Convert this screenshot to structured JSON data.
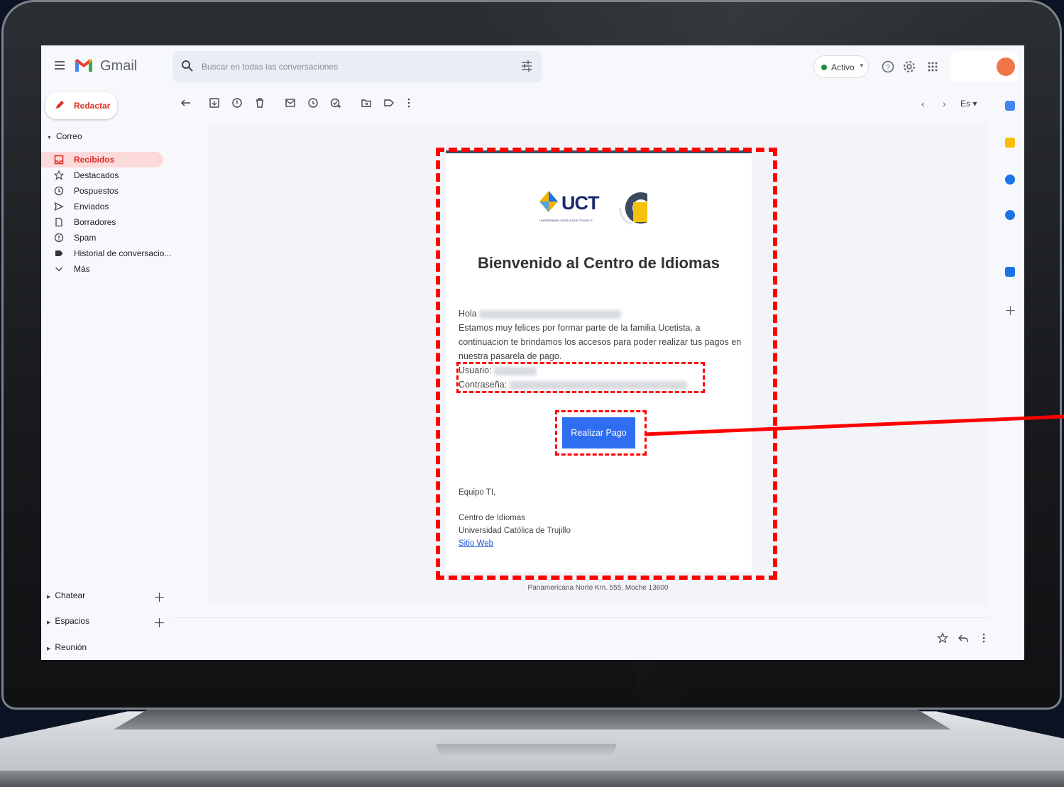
{
  "gmail": {
    "brand": "Gmail",
    "search_placeholder": "Buscar en todas las conversaciones",
    "status": "Activo",
    "compose_label": "Redactar",
    "language": "Es",
    "mail_section": "Correo",
    "nav_items": [
      {
        "label": "Recibidos",
        "icon": "inbox-icon",
        "active": true
      },
      {
        "label": "Destacados",
        "icon": "star-icon",
        "active": false
      },
      {
        "label": "Pospuestos",
        "icon": "clock-icon",
        "active": false
      },
      {
        "label": "Enviados",
        "icon": "send-icon",
        "active": false
      },
      {
        "label": "Borradores",
        "icon": "draft-icon",
        "active": false
      },
      {
        "label": "Spam",
        "icon": "spam-icon",
        "active": false
      },
      {
        "label": "Historial de conversacio...",
        "icon": "label-icon",
        "active": false
      },
      {
        "label": "Más",
        "icon": "chevron-down-icon",
        "active": false
      }
    ],
    "bottom_sections": [
      "Chatear",
      "Espacios",
      "Reunión"
    ]
  },
  "email": {
    "heading": "Bienvenido al Centro de Idiomas",
    "logo_text": "UCT",
    "logo_subtext": "UNIVERSIDAD CATÓLICA DE TRUJILLO",
    "greeting": "Hola",
    "paragraph": "Estamos muy felices por formar parte de la familia Ucetista. a continuacion te brindamos los accesos para poder realizar tus pagos en nuestra pasarela de pago.",
    "user_label": "Usuario:",
    "password_label": "Contraseña:",
    "pay_button": "Realizar Pago",
    "signature_team": "Equipo TI,",
    "signature_center": "Centro de Idiomas",
    "signature_university": "Universidad Católica de Trujillo",
    "website_link": "Sitio Web",
    "footer_address": "Panamericana Norte Km. 555, Moche 13600"
  },
  "colors": {
    "annotation": "#ff0000",
    "button": "#2f6ef0",
    "active_nav": "#fcdada",
    "compose_text": "#d93025"
  }
}
